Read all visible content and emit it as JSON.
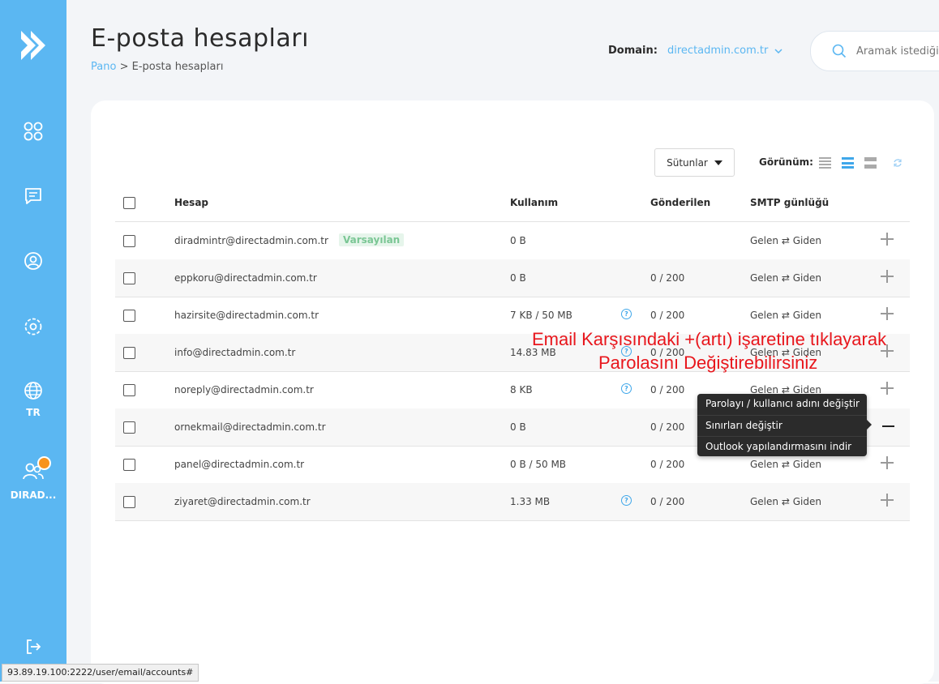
{
  "page": {
    "title": "E-posta hesapları",
    "breadcrumb_home": "Pano",
    "breadcrumb_sep": ">",
    "breadcrumb_current": "E-posta hesapları"
  },
  "domain": {
    "label": "Domain:",
    "value": "directadmin.com.tr"
  },
  "search": {
    "placeholder": "Aramak istediğiniz..."
  },
  "sidebar": {
    "language": "TR",
    "user": "DIRAD..."
  },
  "toolbar": {
    "columns_label": "Sütunlar",
    "view_label": "Görünüm:"
  },
  "table": {
    "headers": {
      "account": "Hesap",
      "usage": "Kullanım",
      "sent": "Gönderilen",
      "smtp": "SMTP günlüğü"
    },
    "rows": [
      {
        "account": "diradmintr@directadmin.com.tr",
        "badge": "Varsayılan",
        "usage": "0 B",
        "sent": "",
        "smtp": "Gelen ⇄ Giden"
      },
      {
        "account": "eppkoru@directadmin.com.tr",
        "usage": "0 B",
        "sent": "0 / 200",
        "smtp": "Gelen ⇄ Giden"
      },
      {
        "account": "hazirsite@directadmin.com.tr",
        "usage": "7 KB / 50 MB",
        "sent": "0 / 200",
        "smtp": "Gelen ⇄ Giden"
      },
      {
        "account": "info@directadmin.com.tr",
        "usage": "14.83 MB",
        "sent": "0 / 200",
        "smtp": "Gelen ⇄ Giden"
      },
      {
        "account": "noreply@directadmin.com.tr",
        "usage": "8 KB",
        "sent": "0 / 200",
        "smtp": "Gelen ⇄ Giden"
      },
      {
        "account": "ornekmail@directadmin.com.tr",
        "usage": "0 B",
        "sent": "0 / 200",
        "smtp": ""
      },
      {
        "account": "panel@directadmin.com.tr",
        "usage": "0 B / 50 MB",
        "sent": "0 / 200",
        "smtp": "Gelen ⇄ Giden"
      },
      {
        "account": "ziyaret@directadmin.com.tr",
        "usage": "1.33 MB",
        "sent": "0 / 200",
        "smtp": "Gelen ⇄ Giden"
      }
    ]
  },
  "context_menu": {
    "items": [
      "Parolayı / kullanıcı adını değiştir",
      "Sınırları değiştir",
      "Outlook yapılandırmasını indir"
    ]
  },
  "annotation": {
    "line1": "Email Karşısındaki +(artı) işaretine tıklayarak",
    "line2": "Parolasını Değiştirebilirsiniz"
  },
  "status_bar": {
    "url": "93.89.19.100:2222/user/email/accounts#"
  },
  "colors": {
    "accent": "#5bb7f2",
    "sidebar": "#5bb7f2",
    "badge_bg": "#e6f5eb",
    "badge_text": "#7ac694",
    "annotation": "#e8161c",
    "notify": "#f7931e"
  }
}
